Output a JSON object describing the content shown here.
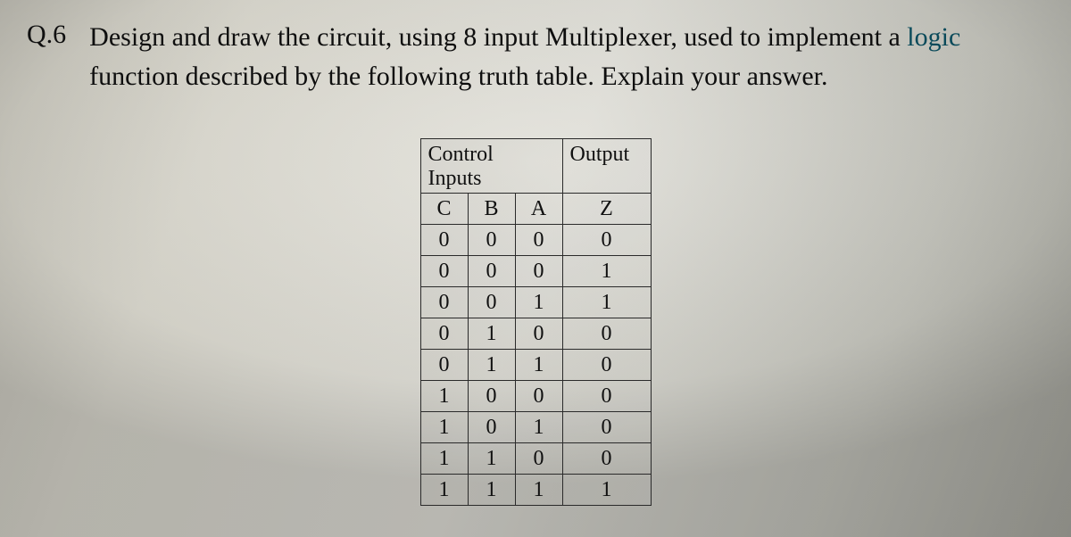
{
  "question": {
    "label": "Q.6",
    "text_part1": "Design and draw the circuit, using 8 input Multiplexer, used to implement a ",
    "text_logic": "logic",
    "text_part2": "function described by the following truth table.  Explain your answer."
  },
  "table": {
    "header_control": "Control",
    "header_inputs": "Inputs",
    "header_output": "Output",
    "col_C": "C",
    "col_B": "B",
    "col_A": "A",
    "col_Z": "Z",
    "rows": [
      {
        "c": "0",
        "b": "0",
        "a": "0",
        "z": "0"
      },
      {
        "c": "0",
        "b": "0",
        "a": "0",
        "z": "1"
      },
      {
        "c": "0",
        "b": "0",
        "a": "1",
        "z": "1"
      },
      {
        "c": "0",
        "b": "1",
        "a": "0",
        "z": "0"
      },
      {
        "c": "0",
        "b": "1",
        "a": "1",
        "z": "0"
      },
      {
        "c": "1",
        "b": "0",
        "a": "0",
        "z": "0"
      },
      {
        "c": "1",
        "b": "0",
        "a": "1",
        "z": "0"
      },
      {
        "c": "1",
        "b": "1",
        "a": "0",
        "z": "0"
      },
      {
        "c": "1",
        "b": "1",
        "a": "1",
        "z": "1"
      }
    ]
  }
}
